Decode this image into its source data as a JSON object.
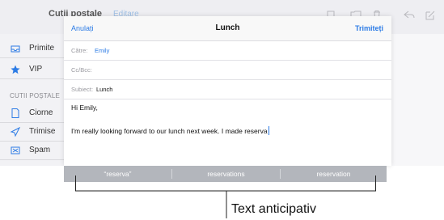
{
  "background": {
    "mailboxes_title": "Cutii poștale",
    "edit_label": "Editare",
    "sidebar": {
      "items": [
        {
          "label": "Primite",
          "icon": "inbox-icon"
        },
        {
          "label": "VIP",
          "icon": "star-icon"
        }
      ],
      "section_label": "CUTII POȘTALE",
      "section_items": [
        {
          "label": "Ciorne",
          "icon": "draft-icon"
        },
        {
          "label": "Trimise",
          "icon": "sent-icon"
        },
        {
          "label": "Spam",
          "icon": "spam-icon"
        }
      ]
    }
  },
  "compose": {
    "cancel_label": "Anulați",
    "title": "Lunch",
    "send_label": "Trimiteți",
    "to_label": "Către:",
    "to_value": "Emily",
    "cc_label": "Cc/Bcc:",
    "subject_label": "Subiect:",
    "subject_value": "Lunch",
    "body_greeting": "Hi Emily,",
    "body_text": "I'm really looking forward to our lunch next week. I made reserva"
  },
  "predictive": {
    "suggestions": [
      "“reserva”",
      "reservations",
      "reservation"
    ]
  },
  "callout": {
    "label": "Text anticipativ"
  },
  "colors": {
    "accent": "#2c7be5",
    "prediction_bar": "#b3b6bc"
  }
}
